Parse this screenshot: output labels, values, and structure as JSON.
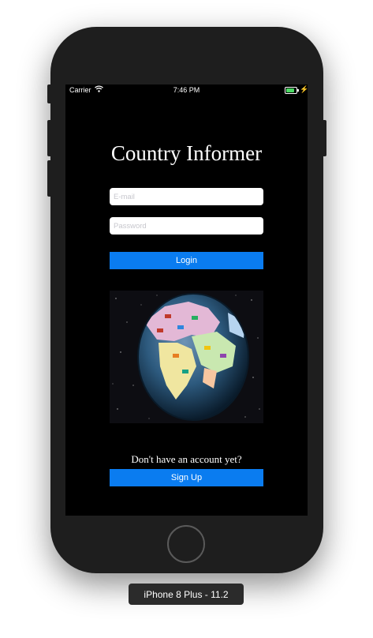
{
  "status_bar": {
    "carrier": "Carrier",
    "time": "7:46 PM",
    "battery_color": "#4cd964"
  },
  "login": {
    "title": "Country Informer",
    "email_placeholder": "E-mail",
    "password_placeholder": "Password",
    "login_label": "Login",
    "signup_prompt": "Don't have an account yet?",
    "signup_label": "Sign Up",
    "accent_color": "#0a7cf0"
  },
  "simulator": {
    "device_label": "iPhone 8 Plus - 11.2"
  }
}
